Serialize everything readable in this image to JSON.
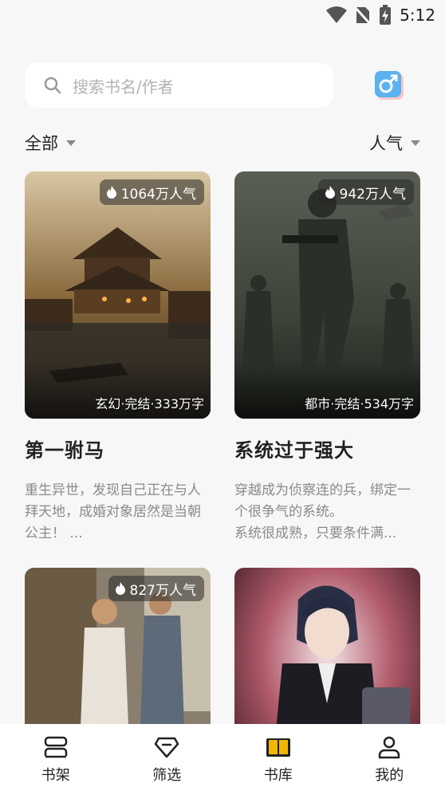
{
  "status_bar": {
    "time": "5:12"
  },
  "search": {
    "placeholder": "搜索书名/作者"
  },
  "filters": {
    "category": "全部",
    "sort": "人气"
  },
  "books": [
    {
      "title": "第一驸马",
      "popularity": "1064万人气",
      "meta": "玄幻·完结·333万字",
      "description": "重生异世，发现自己正在与人拜天地，成婚对象居然是当朝公主！ ..."
    },
    {
      "title": "系统过于强大",
      "popularity": "942万人气",
      "meta": "都市·完结·534万字",
      "description": "穿越成为侦察连的兵，绑定一个很争气的系统。\n系统很成熟，只要条件满..."
    },
    {
      "popularity": "827万人气"
    },
    {}
  ],
  "nav": [
    {
      "label": "书架",
      "icon": "bookshelf-icon"
    },
    {
      "label": "筛选",
      "icon": "diamond-icon"
    },
    {
      "label": "书库",
      "icon": "open-book-icon",
      "active": true
    },
    {
      "label": "我的",
      "icon": "user-icon"
    }
  ],
  "colors": {
    "accent": "#f2b705",
    "gender_badge": "#5bb2f0",
    "background": "#f7f7f7"
  }
}
